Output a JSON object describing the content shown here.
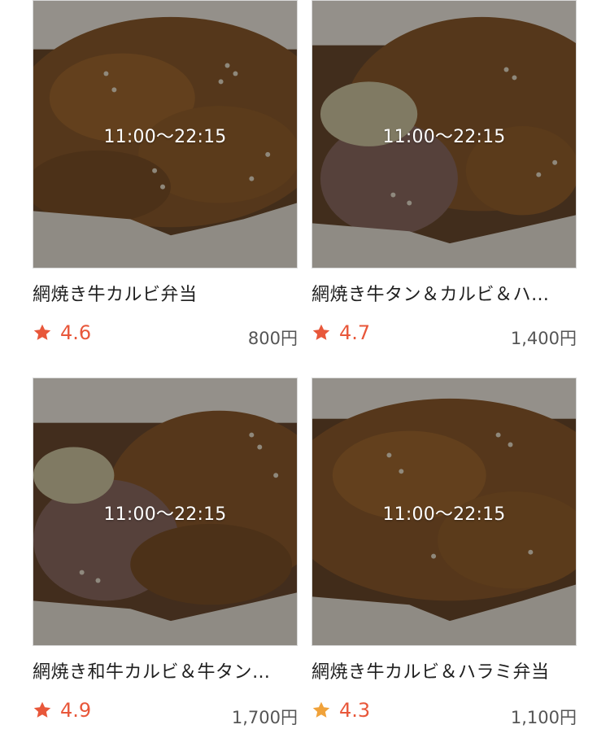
{
  "items": [
    {
      "name": "網焼き牛カルビ弁当",
      "hours": "11:00〜22:15",
      "rating": "4.6",
      "price": "800円",
      "star_color": "#e8573a",
      "image": "grilled-beef-kalbi-bento-photo"
    },
    {
      "name": "網焼き牛タン＆カルビ＆ハ…",
      "hours": "11:00〜22:15",
      "rating": "4.7",
      "price": "1,400円",
      "star_color": "#e8573a",
      "image": "beef-tongue-kalbi-bento-photo"
    },
    {
      "name": "網焼き和牛カルビ＆牛タン…",
      "hours": "11:00〜22:15",
      "rating": "4.9",
      "price": "1,700円",
      "star_color": "#e8573a",
      "image": "wagyu-kalbi-tongue-bento-photo"
    },
    {
      "name": "網焼き牛カルビ＆ハラミ弁当",
      "hours": "11:00〜22:15",
      "rating": "4.3",
      "price": "1,100円",
      "star_color": "#f0a23a",
      "image": "beef-kalbi-harami-bento-photo"
    }
  ],
  "colors": {
    "rating_text": "#e8573a",
    "price_text": "#555555"
  }
}
